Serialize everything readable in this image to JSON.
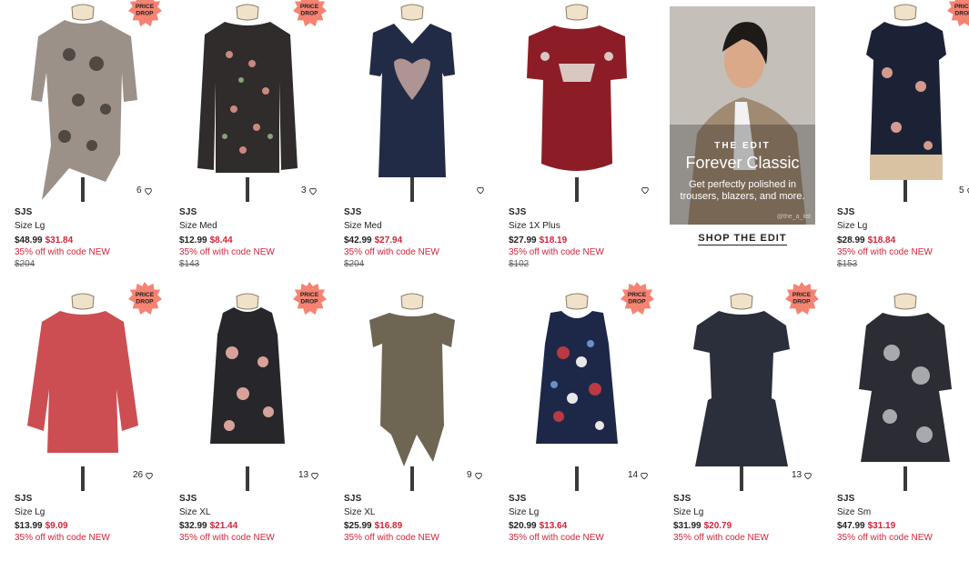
{
  "colors": {
    "sale": "#d3243a",
    "badge": "#f58372"
  },
  "badge_text": [
    "PRICE",
    "DROP"
  ],
  "ad": {
    "eyebrow": "THE EDIT",
    "title": "Forever Classic",
    "body_line1": "Get perfectly polished in",
    "body_line2": "trousers, blazers, and more.",
    "credit": "@the_a_list",
    "cta": "SHOP THE EDIT"
  },
  "row1": [
    {
      "brand": "SJS",
      "size": "Size Lg",
      "price": "$48.99",
      "sale": "$31.84",
      "promo": "35% off with code NEW",
      "orig": "$204",
      "likes": "6"
    },
    {
      "brand": "SJS",
      "size": "Size Med",
      "price": "$12.99",
      "sale": "$8.44",
      "promo": "35% off with code NEW",
      "orig": "$143",
      "likes": "3"
    },
    {
      "brand": "SJS",
      "size": "Size Med",
      "price": "$42.99",
      "sale": "$27.94",
      "promo": "35% off with code NEW",
      "orig": "$204",
      "likes": ""
    },
    {
      "brand": "SJS",
      "size": "Size 1X Plus",
      "price": "$27.99",
      "sale": "$18.19",
      "promo": "35% off with code NEW",
      "orig": "$102",
      "likes": ""
    },
    {
      "brand": "SJS",
      "size": "Size Lg",
      "price": "$28.99",
      "sale": "$18.84",
      "promo": "35% off with code NEW",
      "orig": "$153",
      "likes": "5"
    }
  ],
  "row2": [
    {
      "brand": "SJS",
      "size": "Size Lg",
      "price": "$13.99",
      "sale": "$9.09",
      "promo": "35% off with code NEW",
      "likes": "26"
    },
    {
      "brand": "SJS",
      "size": "Size XL",
      "price": "$32.99",
      "sale": "$21.44",
      "promo": "35% off with code NEW",
      "likes": "13"
    },
    {
      "brand": "SJS",
      "size": "Size XL",
      "price": "$25.99",
      "sale": "$16.89",
      "promo": "35% off with code NEW",
      "likes": "9"
    },
    {
      "brand": "SJS",
      "size": "Size Lg",
      "price": "$20.99",
      "sale": "$13.64",
      "promo": "35% off with code NEW",
      "likes": "14"
    },
    {
      "brand": "SJS",
      "size": "Size Lg",
      "price": "$31.99",
      "sale": "$20.79",
      "promo": "35% off with code NEW",
      "likes": "13"
    },
    {
      "brand": "SJS",
      "size": "Size Sm",
      "price": "$47.99",
      "sale": "$31.19",
      "promo": "35% off with code NEW",
      "likes": ""
    }
  ]
}
